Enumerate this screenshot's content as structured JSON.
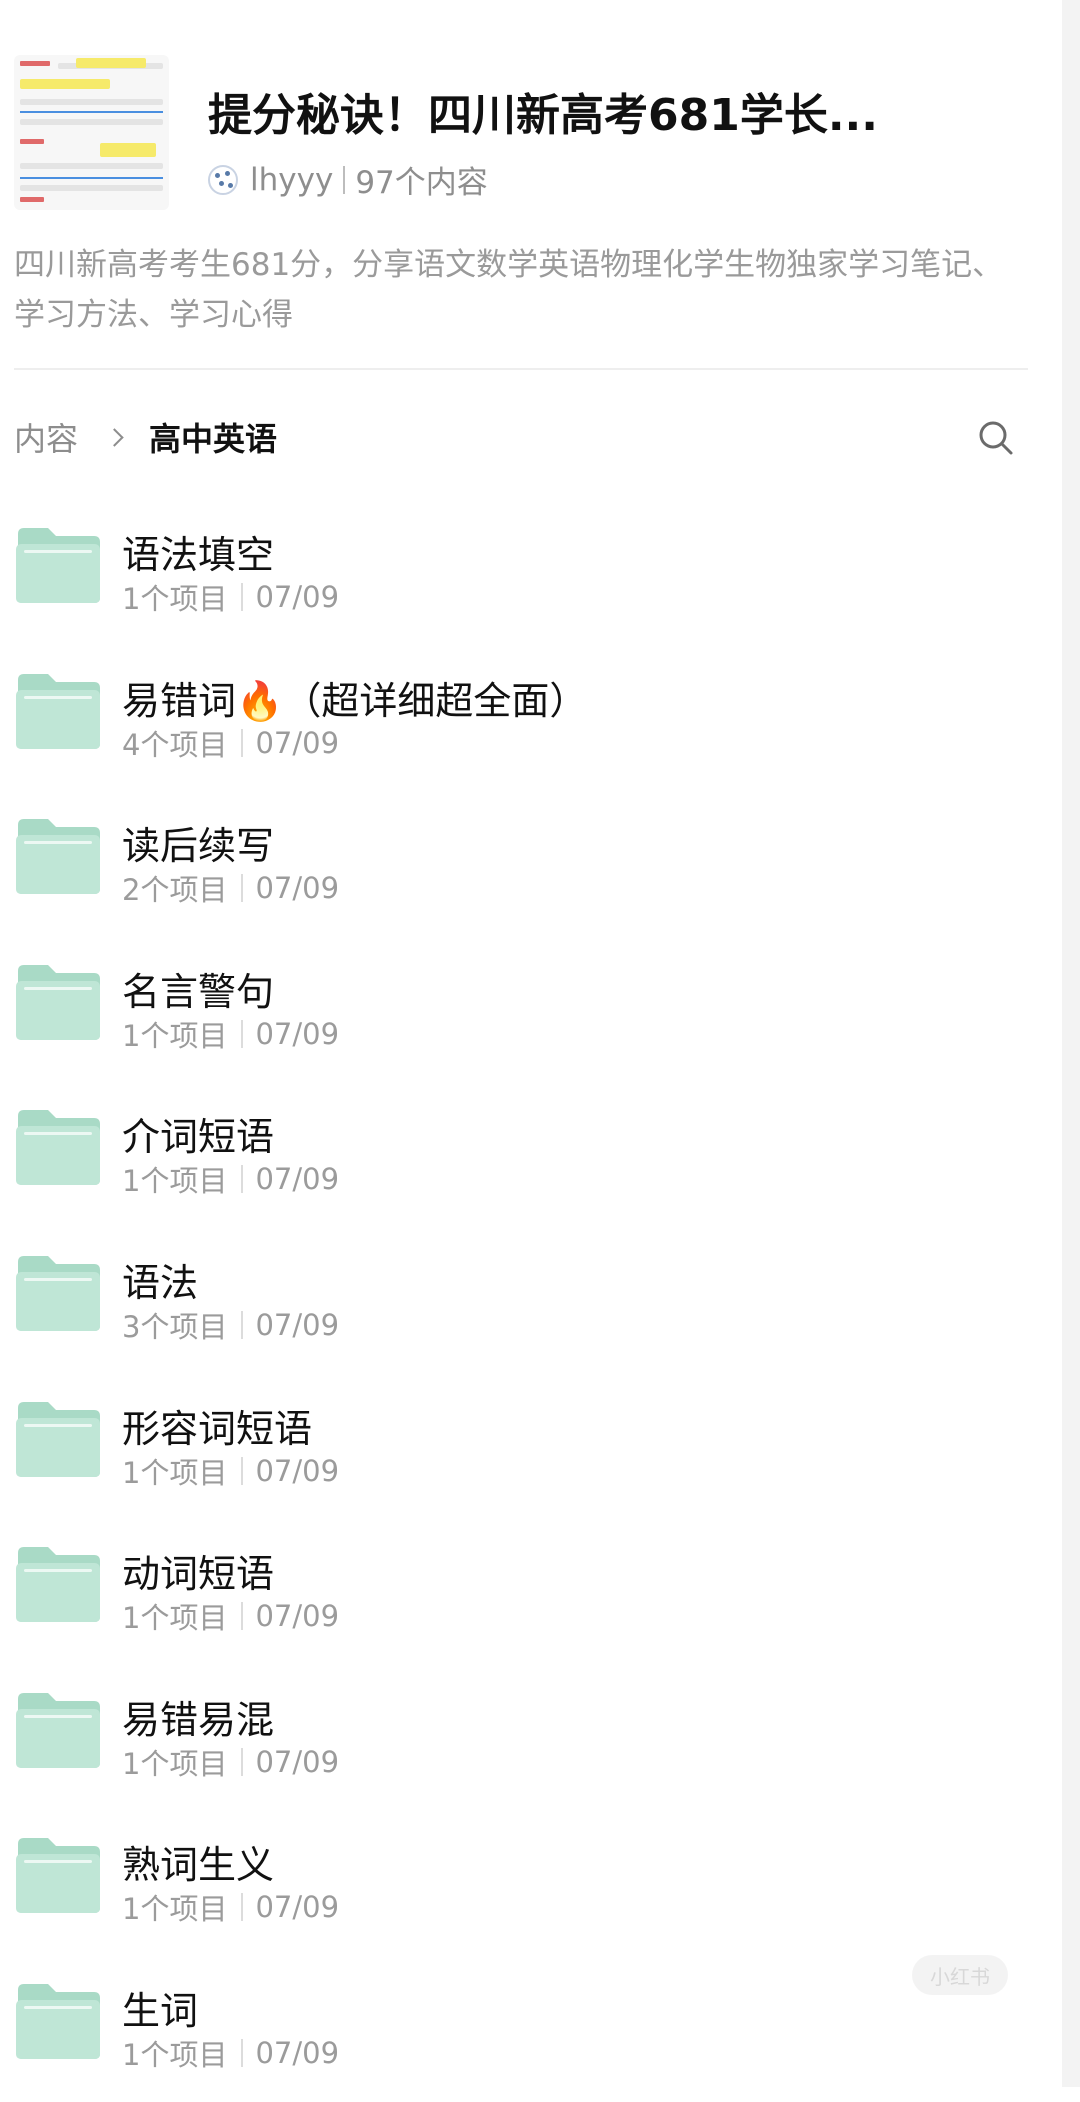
{
  "header": {
    "title": "提分秘诀！四川新高考681学长...",
    "username": "lhyyy",
    "content_count": "97个内容",
    "description": "四川新高考考生681分，分享语文数学英语物理化学生物独家学习笔记、学习方法、学习心得"
  },
  "breadcrumb": {
    "root": "内容",
    "current": "高中英语"
  },
  "search": {
    "icon": "search-icon"
  },
  "colors": {
    "folder": "#bfe6d6",
    "folder_dark": "#a9dac6",
    "text_primary": "#111111",
    "text_secondary": "#9b9b9b"
  },
  "folders": [
    {
      "name": "语法填空",
      "count": "1个项目",
      "date": "07/09"
    },
    {
      "name": "易错词🔥（超详细超全面）",
      "count": "4个项目",
      "date": "07/09"
    },
    {
      "name": "读后续写",
      "count": "2个项目",
      "date": "07/09"
    },
    {
      "name": "名言警句",
      "count": "1个项目",
      "date": "07/09"
    },
    {
      "name": "介词短语",
      "count": "1个项目",
      "date": "07/09"
    },
    {
      "name": "语法",
      "count": "3个项目",
      "date": "07/09"
    },
    {
      "name": "形容词短语",
      "count": "1个项目",
      "date": "07/09"
    },
    {
      "name": "动词短语",
      "count": "1个项目",
      "date": "07/09"
    },
    {
      "name": "易错易混",
      "count": "1个项目",
      "date": "07/09"
    },
    {
      "name": "熟词生义",
      "count": "1个项目",
      "date": "07/09"
    },
    {
      "name": "生词",
      "count": "1个项目",
      "date": "07/09"
    }
  ],
  "watermark": "小红书"
}
